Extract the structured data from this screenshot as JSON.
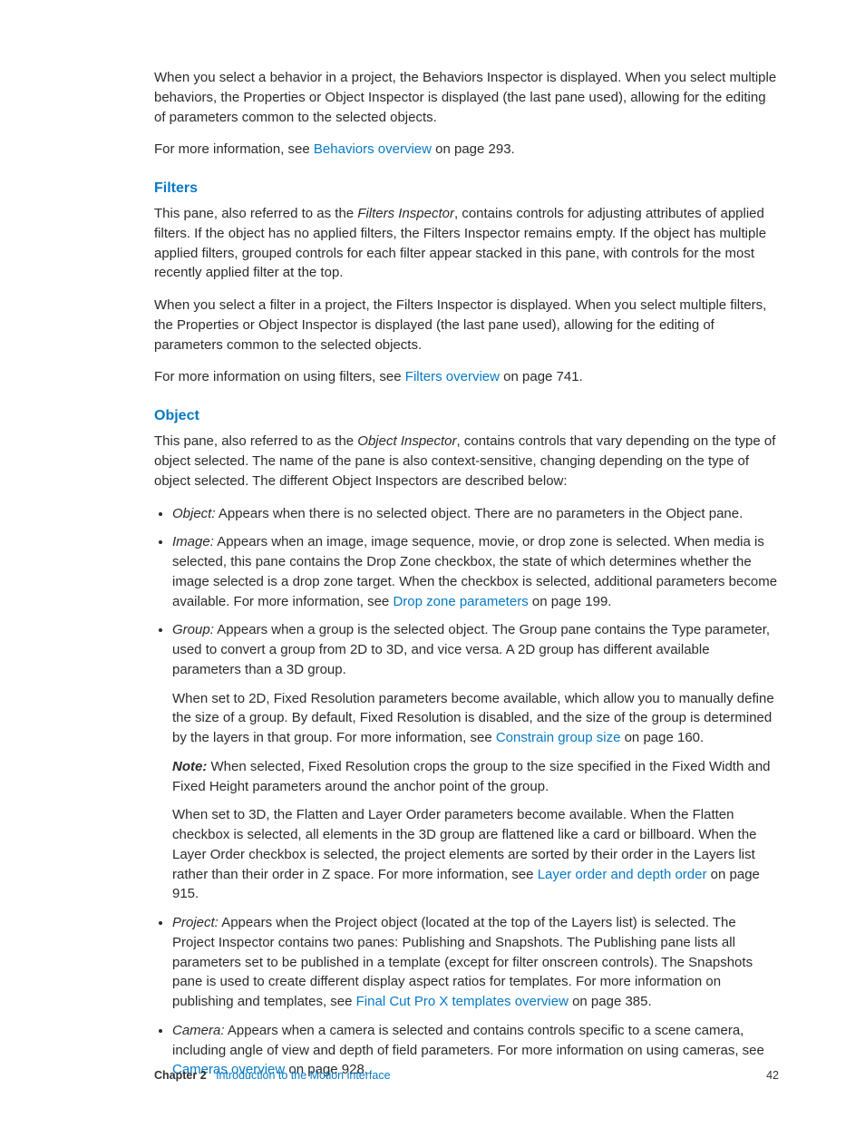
{
  "intro": {
    "p1": "When you select a behavior in a project, the Behaviors Inspector is displayed. When you select multiple behaviors, the Properties or Object Inspector is displayed (the last pane used), allowing for the editing of parameters common to the selected objects.",
    "p2_pre": "For more information, see ",
    "p2_link": "Behaviors overview",
    "p2_post": " on page 293."
  },
  "filters": {
    "heading": "Filters",
    "p1_pre": "This pane, also referred to as the ",
    "p1_term": "Filters Inspector",
    "p1_post": ", contains controls for adjusting attributes of applied filters. If the object has no applied filters, the Filters Inspector remains empty. If the object has multiple applied filters, grouped controls for each filter appear stacked in this pane, with controls for the most recently applied filter at the top.",
    "p2": "When you select a filter in a project, the Filters Inspector is displayed. When you select multiple filters, the Properties or Object Inspector is displayed (the last pane used), allowing for the editing of parameters common to the selected objects.",
    "p3_pre": "For more information on using filters, see ",
    "p3_link": "Filters overview",
    "p3_post": " on page 741."
  },
  "object": {
    "heading": "Object",
    "p1_pre": "This pane, also referred to as the ",
    "p1_term": "Object Inspector",
    "p1_post": ", contains controls that vary depending on the type of object selected. The name of the pane is also context-sensitive, changing depending on the type of object selected. The different Object Inspectors are described below:",
    "li1_label": "Object:",
    "li1_text": " Appears when there is no selected object. There are no parameters in the Object pane.",
    "li2_label": "Image:",
    "li2_text_pre": " Appears when an image, image sequence, movie, or drop zone is selected. When media is selected, this pane contains the Drop Zone checkbox, the state of which determines whether the image selected is a drop zone target. When the checkbox is selected, additional parameters become available. For more information, see ",
    "li2_link": "Drop zone parameters",
    "li2_text_post": " on page 199.",
    "li3_label": "Group:",
    "li3_p1": " Appears when a group is the selected object. The Group pane contains the Type parameter, used to convert a group from 2D to 3D, and vice versa. A 2D group has different available parameters than a 3D group.",
    "li3_p2_pre": "When set to 2D, Fixed Resolution parameters become available, which allow you to manually define the size of a group. By default, Fixed Resolution is disabled, and the size of the group is determined by the layers in that group. For more information, see ",
    "li3_p2_link": "Constrain group size",
    "li3_p2_post": " on page 160.",
    "li3_note_label": "Note:  ",
    "li3_note_text": "When selected, Fixed Resolution crops the group to the size specified in the Fixed Width and Fixed Height parameters around the anchor point of the group.",
    "li3_p4_pre": "When set to 3D, the Flatten and Layer Order parameters become available. When the Flatten checkbox is selected, all elements in the 3D group are flattened like a card or billboard. When the Layer Order checkbox is selected, the project elements are sorted by their order in the Layers list rather than their order in Z space. For more information, see ",
    "li3_p4_link": "Layer order and depth order",
    "li3_p4_post": " on page 915.",
    "li4_label": "Project:",
    "li4_text_pre": " Appears when the Project object (located at the top of the Layers list) is selected. The Project Inspector contains two panes: Publishing and Snapshots. The Publishing pane lists all parameters set to be published in a template (except for filter onscreen controls). The Snapshots pane is used to create different display aspect ratios for templates. For more information on publishing and templates, see ",
    "li4_link": "Final Cut Pro X templates overview",
    "li4_text_post": " on page 385.",
    "li5_label": "Camera:",
    "li5_text_pre": " Appears when a camera is selected and contains controls specific to a scene camera, including angle of view and depth of field parameters. For more information on using cameras, see ",
    "li5_link": "Cameras overview",
    "li5_text_post": " on page 928."
  },
  "footer": {
    "chapter_label": "Chapter 2",
    "chapter_title": "Introduction to the Motion interface",
    "page_number": "42"
  }
}
